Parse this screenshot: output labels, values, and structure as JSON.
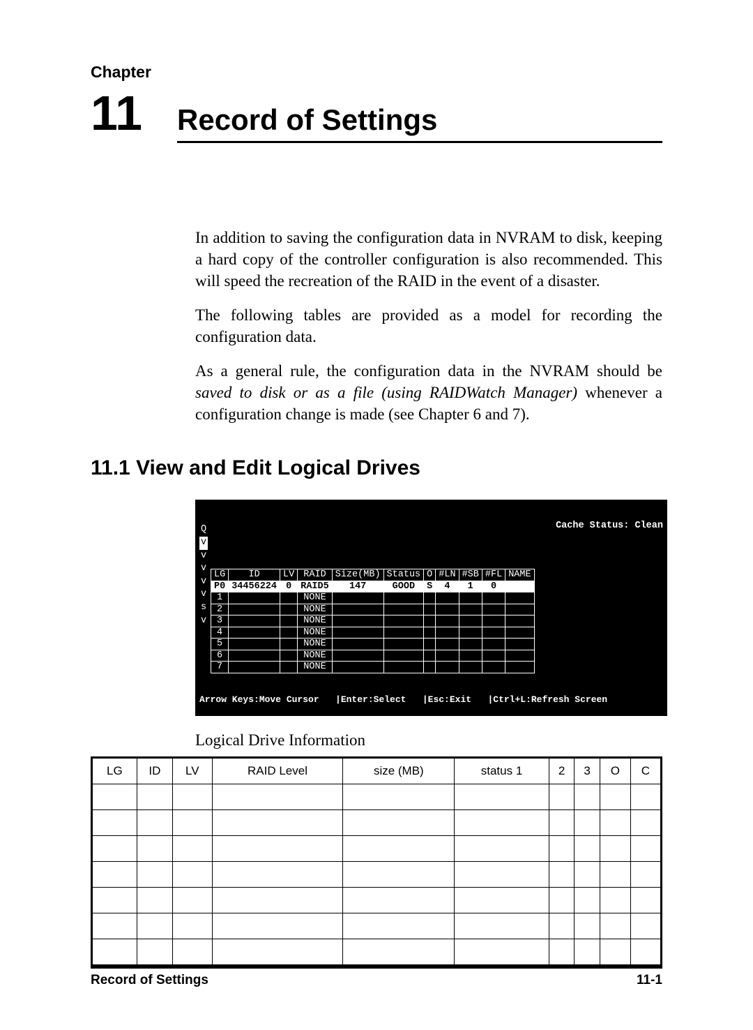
{
  "header": {
    "chapter_label": "Chapter",
    "chapter_number": "11",
    "chapter_title": "Record of Settings"
  },
  "body": {
    "p1": "In addition to saving the configuration data in NVRAM to disk, keeping a hard copy of the controller configuration is also recommended.  This will speed the recreation of the RAID in the event of a disaster.",
    "p2": "The following tables are provided as a model for recording the configuration data.",
    "p3a": "As a general rule, the configuration data in the NVRAM should be ",
    "p3_italic": "saved to disk or as a file (using RAIDWatch Manager)",
    "p3b": " whenever a configuration change is made (see Chapter 6 and 7)."
  },
  "section": {
    "heading": "11.1 View and Edit Logical Drives"
  },
  "terminal": {
    "cache_status": "Cache Status: Clean",
    "side_letters": [
      "Q",
      "v",
      "v",
      "v",
      "v",
      "v",
      "s",
      "v"
    ],
    "headers": [
      "LG",
      "ID",
      "LV",
      "RAID",
      "Size(MB)",
      "Status",
      "O",
      "#LN",
      "#SB",
      "#FL",
      "NAME"
    ],
    "rows": [
      {
        "hl": true,
        "cells": [
          "P0",
          "34456224",
          "0",
          "RAID5",
          "147",
          "GOOD",
          "S",
          "4",
          "1",
          "0",
          ""
        ]
      },
      {
        "hl": false,
        "cells": [
          "1",
          "",
          "",
          "NONE",
          "",
          "",
          "",
          "",
          "",
          "",
          ""
        ]
      },
      {
        "hl": false,
        "cells": [
          "2",
          "",
          "",
          "NONE",
          "",
          "",
          "",
          "",
          "",
          "",
          ""
        ]
      },
      {
        "hl": false,
        "cells": [
          "3",
          "",
          "",
          "NONE",
          "",
          "",
          "",
          "",
          "",
          "",
          ""
        ]
      },
      {
        "hl": false,
        "cells": [
          "4",
          "",
          "",
          "NONE",
          "",
          "",
          "",
          "",
          "",
          "",
          ""
        ]
      },
      {
        "hl": false,
        "cells": [
          "5",
          "",
          "",
          "NONE",
          "",
          "",
          "",
          "",
          "",
          "",
          ""
        ]
      },
      {
        "hl": false,
        "cells": [
          "6",
          "",
          "",
          "NONE",
          "",
          "",
          "",
          "",
          "",
          "",
          ""
        ]
      },
      {
        "hl": false,
        "cells": [
          "7",
          "",
          "",
          "NONE",
          "",
          "",
          "",
          "",
          "",
          "",
          ""
        ]
      }
    ],
    "footer": "Arrow Keys:Move Cursor   |Enter:Select   |Esc:Exit   |Ctrl+L:Refresh Screen"
  },
  "caption": "Logical Drive Information",
  "record_table": {
    "headers": [
      "LG",
      "ID",
      "LV",
      "RAID Level",
      "size (MB)",
      "status 1",
      "2",
      "3",
      "O",
      "C"
    ],
    "blank_row_count": 7
  },
  "footer": {
    "left": "Record of Settings",
    "right": "11-1"
  }
}
